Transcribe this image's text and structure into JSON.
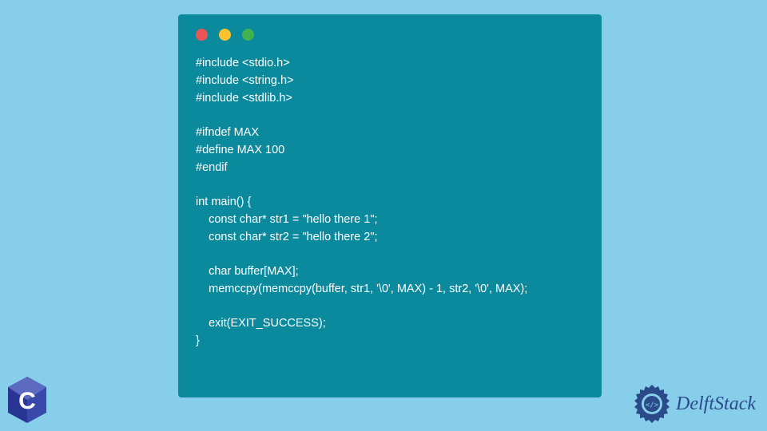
{
  "code_lines": [
    "#include <stdio.h>",
    "#include <string.h>",
    "#include <stdlib.h>",
    "",
    "#ifndef MAX",
    "#define MAX 100",
    "#endif",
    "",
    "int main() {",
    "    const char* str1 = \"hello there 1\";",
    "    const char* str2 = \"hello there 2\";",
    "",
    "    char buffer[MAX];",
    "    memccpy(memccpy(buffer, str1, '\\0', MAX) - 1, str2, '\\0', MAX);",
    "",
    "    exit(EXIT_SUCCESS);",
    "}"
  ],
  "brand": {
    "name": "DelftStack"
  },
  "colors": {
    "background": "#87ceeb",
    "window": "#0b8a9e",
    "code_text": "#ffffff",
    "brand_text": "#2b4a8a"
  }
}
